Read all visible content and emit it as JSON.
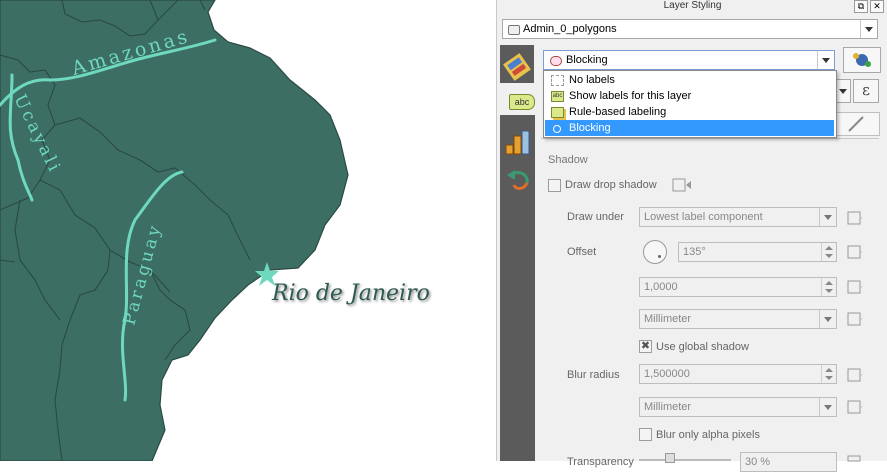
{
  "window": {
    "title": "Layer Styling",
    "float_symbol": "⧉",
    "close_symbol": "✕"
  },
  "layer_combo": {
    "value": "Admin_0_polygons"
  },
  "mode_combo": {
    "value": "Blocking"
  },
  "mode_menu": {
    "options": [
      "No labels",
      "Show labels for this layer",
      "Rule-based labeling",
      "Blocking"
    ],
    "selected": "Blocking"
  },
  "abc_badge": "abc",
  "epsilon_symbol": "ε",
  "shadow": {
    "heading": "Shadow",
    "draw_drop_shadow_label": "Draw drop shadow",
    "draw_under_label": "Draw under",
    "draw_under_value": "Lowest label component",
    "offset_label": "Offset",
    "offset_angle": "135°",
    "offset_distance": "1,0000",
    "offset_unit": "Millimeter",
    "use_global_label": "Use global shadow",
    "use_global_checked": true,
    "blur_radius_label": "Blur radius",
    "blur_radius_value": "1,500000",
    "blur_unit": "Millimeter",
    "blur_alpha_label": "Blur only alpha pixels",
    "transparency_label": "Transparency",
    "transparency_value": "30 %"
  },
  "map": {
    "labels": {
      "rio": "Rio de Janeiro",
      "amazonas": "Amazonas",
      "ucayali": "Ucayali",
      "paraguay": "Paraguay"
    },
    "colors": {
      "land": "#3d6e64",
      "border": "#2a4a43",
      "river": "#6fd9c0"
    }
  }
}
